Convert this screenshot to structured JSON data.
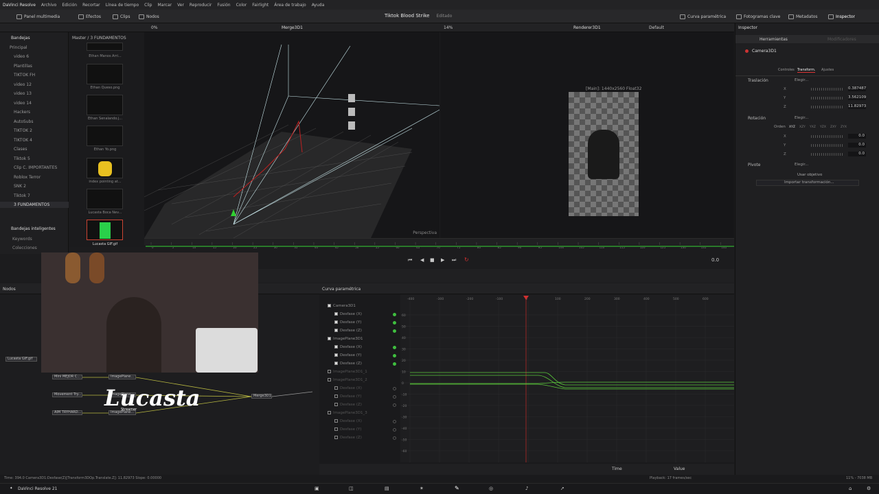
{
  "menubar": {
    "app": "DaVinci Resolve",
    "items": [
      "Archivo",
      "Edición",
      "Recortar",
      "Línea de tiempo",
      "Clip",
      "Marcar",
      "Ver",
      "Reproducir",
      "Fusión",
      "Color",
      "Fairlight",
      "Área de trabajo",
      "Ayuda"
    ]
  },
  "toolbar": {
    "media_pool": "Panel multimedia",
    "effects": "Efectos",
    "clips": "Clips",
    "nodes": "Nodos",
    "project_title": "Tiktok Blood Strike",
    "project_status": "Editado",
    "param_curve": "Curva paramétrica",
    "keyframes": "Fotogramas clave",
    "metadata": "Metadatos",
    "inspector": "Inspector"
  },
  "subbar": {
    "zoom_left": "0%",
    "viewer_left_title": "Merge3D1",
    "zoom_right": "14%",
    "viewer_right_title": "Renderer3D1",
    "lut": "Default"
  },
  "media": {
    "bins_label": "Bandejas",
    "path": "Master / 3 FUNDAMENTOS",
    "bins": [
      "Principal",
      "video 6",
      "Plantillas",
      "TIKTOK FH",
      "video 12",
      "video 13",
      "video 14",
      "Hackers",
      "AutoSubs",
      "TIKTOK 2",
      "TIKTOK 4",
      "Clases",
      "Tiktok 5",
      "Clip C. IMPORTANTES",
      "Roblox Terror",
      "SNK 2",
      "Tiktok 7",
      "3 FUNDAMENTOS"
    ],
    "smart_bins": "Bandejas inteligentes",
    "smart_items": [
      "Keywords",
      "Colecciones"
    ],
    "thumbs": [
      "Ethan Manos Arri...",
      "Ethan Queso.png",
      "Ethan Senalando.j...",
      "Ethan Yo.png",
      "index pointing at...",
      "Lucasta Boca Nev...",
      "Lucasta GIF.gif"
    ]
  },
  "viewers": {
    "left_label": "Perspectiva",
    "right_label": "[Main]: 1440x2560 Float32",
    "timecode": "0.0",
    "ruler_ticks": [
      "0",
      "5",
      "10",
      "15",
      "20",
      "25",
      "30",
      "35",
      "40",
      "45",
      "50",
      "55",
      "60",
      "65",
      "70",
      "75",
      "80",
      "85",
      "90",
      "95",
      "100",
      "105",
      "110",
      "115",
      "120",
      "125",
      "130",
      "135",
      "140"
    ]
  },
  "inspector": {
    "header": "Inspector",
    "tools_tab": "Herramientas",
    "modifiers_tab": "Modificadores",
    "node_name": "Camera3D1",
    "subtabs": [
      "Controles",
      "Transform.",
      "Ajustes"
    ],
    "translation": "Traslación",
    "choose": "Elegir...",
    "tx": "0.387487",
    "ty": "3.562109",
    "tz": "11.82973",
    "rotation": "Rotación",
    "order_label": "Orden",
    "orders": [
      "XYZ",
      "XZY",
      "YXZ",
      "YZX",
      "ZXY",
      "ZYX"
    ],
    "rx": "0.0",
    "ry": "0.0",
    "rz": "0.0",
    "pivot": "Pivote",
    "use_target": "Usar objetivo",
    "import_transform": "Importar transformación..."
  },
  "nodes": {
    "label": "Nodos",
    "items": [
      "Lucasta GIF.gif",
      "Mini MEJOR C...",
      "Movement Try...",
      "AIM TRYHARD...",
      "ImagePlane...",
      "ImagePlane...",
      "ImagePlane...",
      "Merge3D1"
    ],
    "watermark": "Lucasta",
    "watermark_sub": "Streamer"
  },
  "curves": {
    "title": "Curva paramétrica",
    "tree": [
      {
        "label": "Camera3D1",
        "level": 0,
        "on": true,
        "dot": "none"
      },
      {
        "label": "Desfase (X)",
        "level": 1,
        "on": true,
        "dot": "green"
      },
      {
        "label": "Desfase (Y)",
        "level": 1,
        "on": true,
        "dot": "green"
      },
      {
        "label": "Desfase (Z)",
        "level": 1,
        "on": true,
        "dot": "green"
      },
      {
        "label": "ImagePlane3D1",
        "level": 0,
        "on": true,
        "dot": "none"
      },
      {
        "label": "Desfase (X)",
        "level": 1,
        "on": true,
        "dot": "green"
      },
      {
        "label": "Desfase (Y)",
        "level": 1,
        "on": true,
        "dot": "green"
      },
      {
        "label": "Desfase (Z)",
        "level": 1,
        "on": true,
        "dot": "green"
      },
      {
        "label": "ImagePlane3D1_1",
        "level": 0,
        "on": false,
        "dot": "none"
      },
      {
        "label": "ImagePlane3D1_2",
        "level": 0,
        "on": false,
        "dot": "none"
      },
      {
        "label": "Desfase (X)",
        "level": 1,
        "on": false,
        "dot": "empty"
      },
      {
        "label": "Desfase (Y)",
        "level": 1,
        "on": false,
        "dot": "empty"
      },
      {
        "label": "Desfase (Z)",
        "level": 1,
        "on": false,
        "dot": "empty"
      },
      {
        "label": "ImagePlane3D1_3",
        "level": 0,
        "on": false,
        "dot": "none"
      },
      {
        "label": "Desfase (X)",
        "level": 1,
        "on": false,
        "dot": "empty"
      },
      {
        "label": "Desfase (Y)",
        "level": 1,
        "on": false,
        "dot": "empty"
      },
      {
        "label": "Desfase (Z)",
        "level": 1,
        "on": false,
        "dot": "empty"
      }
    ],
    "x_ticks": [
      "-400",
      "-300",
      "-200",
      "-100",
      "0",
      "100",
      "200",
      "300",
      "400",
      "500",
      "600"
    ],
    "y_ticks": [
      "60",
      "50",
      "40",
      "30",
      "20",
      "10",
      "0",
      "-10",
      "-20",
      "-30",
      "-40",
      "-50",
      "-60"
    ],
    "time_select": "Time",
    "value_select": "Value"
  },
  "status": {
    "left": "Time: 394.0     Camera3D1:Desfase(Z)[Transform3DOp.Translate.Z]: 11.82973     Slope: 0.00000",
    "playback": "Playback: 17 frames/sec",
    "memory": "11% - 7038 MB"
  },
  "pagebar": {
    "app": "DaVinci Resolve 21"
  }
}
